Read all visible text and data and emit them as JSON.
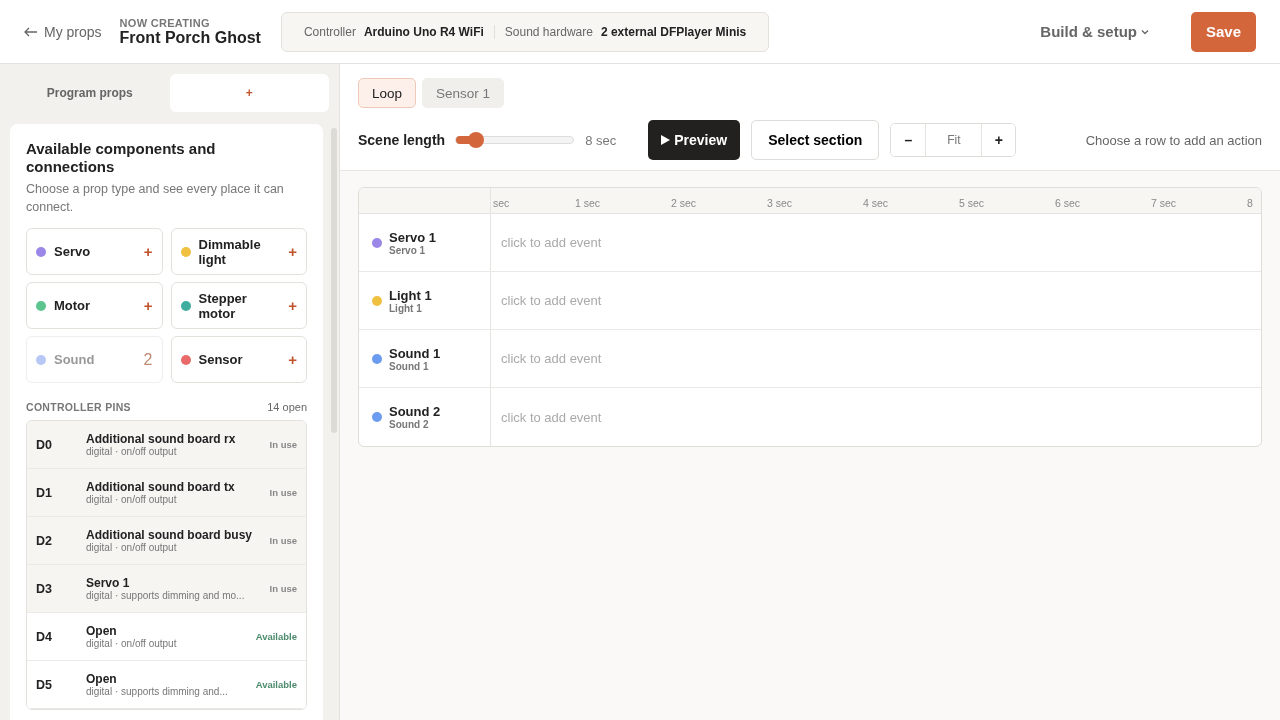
{
  "header": {
    "back_link": "My props",
    "eyebrow": "NOW CREATING",
    "title": "Front Porch Ghost",
    "info": [
      {
        "label": "Controller",
        "value": "Arduino Uno R4 WiFi"
      },
      {
        "label": "Sound hardware",
        "value": "2 external DFPlayer Minis"
      }
    ],
    "menu": "Build & setup",
    "save": "Save"
  },
  "sidebar": {
    "tabs": [
      {
        "label": "Program props",
        "selected": false
      },
      {
        "label": "+",
        "selected": true
      }
    ],
    "title": "Available components and connections",
    "description": "Choose a prop type and see every place it can connect.",
    "components": [
      {
        "label": "Servo",
        "color": "#9b87e8",
        "action": "+",
        "disabled": false
      },
      {
        "label": "Dimmable light",
        "color": "#f0c040",
        "action": "+",
        "disabled": false
      },
      {
        "label": "Motor",
        "color": "#5cc48e",
        "action": "+",
        "disabled": false
      },
      {
        "label": "Stepper motor",
        "color": "#3fae9e",
        "action": "+",
        "disabled": false
      },
      {
        "label": "Sound",
        "color": "#b8c8f4",
        "action": "2",
        "disabled": true
      },
      {
        "label": "Sensor",
        "color": "#e86a6a",
        "action": "+",
        "disabled": false
      }
    ],
    "pins_heading": "CONTROLLER PINS",
    "pins_count": "14 open",
    "pins": [
      {
        "pin": "D0",
        "name": "Additional sound board rx",
        "detail": "digital · on/off output",
        "status": "In use",
        "in_use": true
      },
      {
        "pin": "D1",
        "name": "Additional sound board tx",
        "detail": "digital · on/off output",
        "status": "In use",
        "in_use": true
      },
      {
        "pin": "D2",
        "name": "Additional sound board busy",
        "detail": "digital · on/off output",
        "status": "In use",
        "in_use": true
      },
      {
        "pin": "D3",
        "name": "Servo 1",
        "detail": "digital · supports dimming and mo...",
        "status": "In use",
        "in_use": true
      },
      {
        "pin": "D4",
        "name": "Open",
        "detail": "digital · on/off output",
        "status": "Available",
        "in_use": false
      },
      {
        "pin": "D5",
        "name": "Open",
        "detail": "digital · supports dimming and...",
        "status": "Available",
        "in_use": false
      }
    ]
  },
  "main": {
    "tabs": [
      {
        "label": "Loop",
        "selected": true
      },
      {
        "label": "Sensor 1",
        "selected": false
      }
    ],
    "scene_length": {
      "label": "Scene length",
      "level": 0.17,
      "reading": "8 sec"
    },
    "preview": "Preview",
    "select_section": "Select section",
    "zoom": {
      "minus": "–",
      "fit": "Fit",
      "plus": "+"
    },
    "hint": "Choose a row to add an action",
    "ticks": [
      "sec",
      "1 sec",
      "2 sec",
      "3 sec",
      "4 sec",
      "5 sec",
      "6 sec",
      "7 sec",
      "8"
    ],
    "tracks": [
      {
        "name": "Servo 1",
        "sub": "Servo 1",
        "color": "#9b87e8",
        "placeholder": "click to add event"
      },
      {
        "name": "Light 1",
        "sub": "Light 1",
        "color": "#f0c040",
        "placeholder": "click to add event"
      },
      {
        "name": "Sound 1",
        "sub": "Sound 1",
        "color": "#6b9cf0",
        "placeholder": "click to add event"
      },
      {
        "name": "Sound 2",
        "sub": "Sound 2",
        "color": "#6b9cf0",
        "placeholder": "click to add event"
      }
    ]
  }
}
